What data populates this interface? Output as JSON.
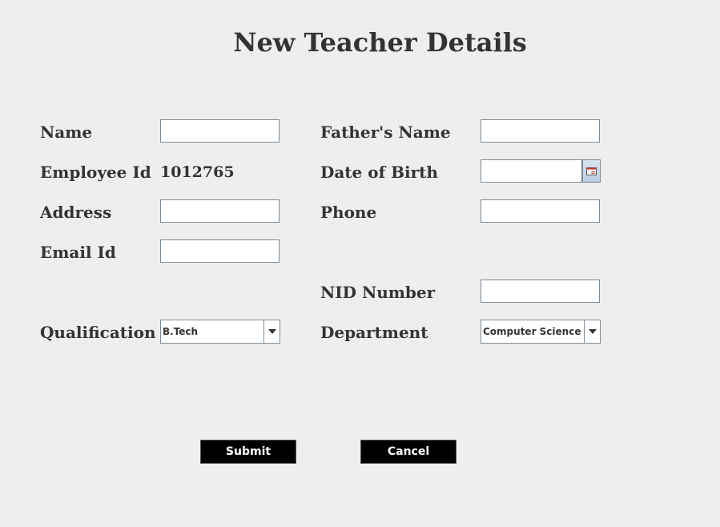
{
  "form": {
    "title": "New Teacher Details",
    "labels": {
      "name": "Name",
      "employee_id": "Employee Id",
      "address": "Address",
      "email_id": "Email Id",
      "qualification": "Qualification",
      "fathers_name": "Father's Name",
      "date_of_birth": "Date of Birth",
      "phone": "Phone",
      "nid_number": "NID Number",
      "department": "Department"
    },
    "values": {
      "name": "",
      "employee_id": "1012765",
      "address": "",
      "email_id": "",
      "fathers_name": "",
      "date_of_birth": "",
      "phone": "",
      "nid_number": ""
    },
    "qualification": {
      "selected": "B.Tech"
    },
    "department": {
      "selected": "Computer Science"
    },
    "buttons": {
      "submit": "Submit",
      "cancel": "Cancel"
    },
    "icons": {
      "date_picker": "calendar-icon",
      "dropdown": "chevron-down-icon"
    },
    "colors": {
      "background": "#eeeeee",
      "text": "#333333",
      "button_bg": "#000000",
      "button_text": "#ffffff",
      "field_border": "#7a8a99"
    }
  }
}
